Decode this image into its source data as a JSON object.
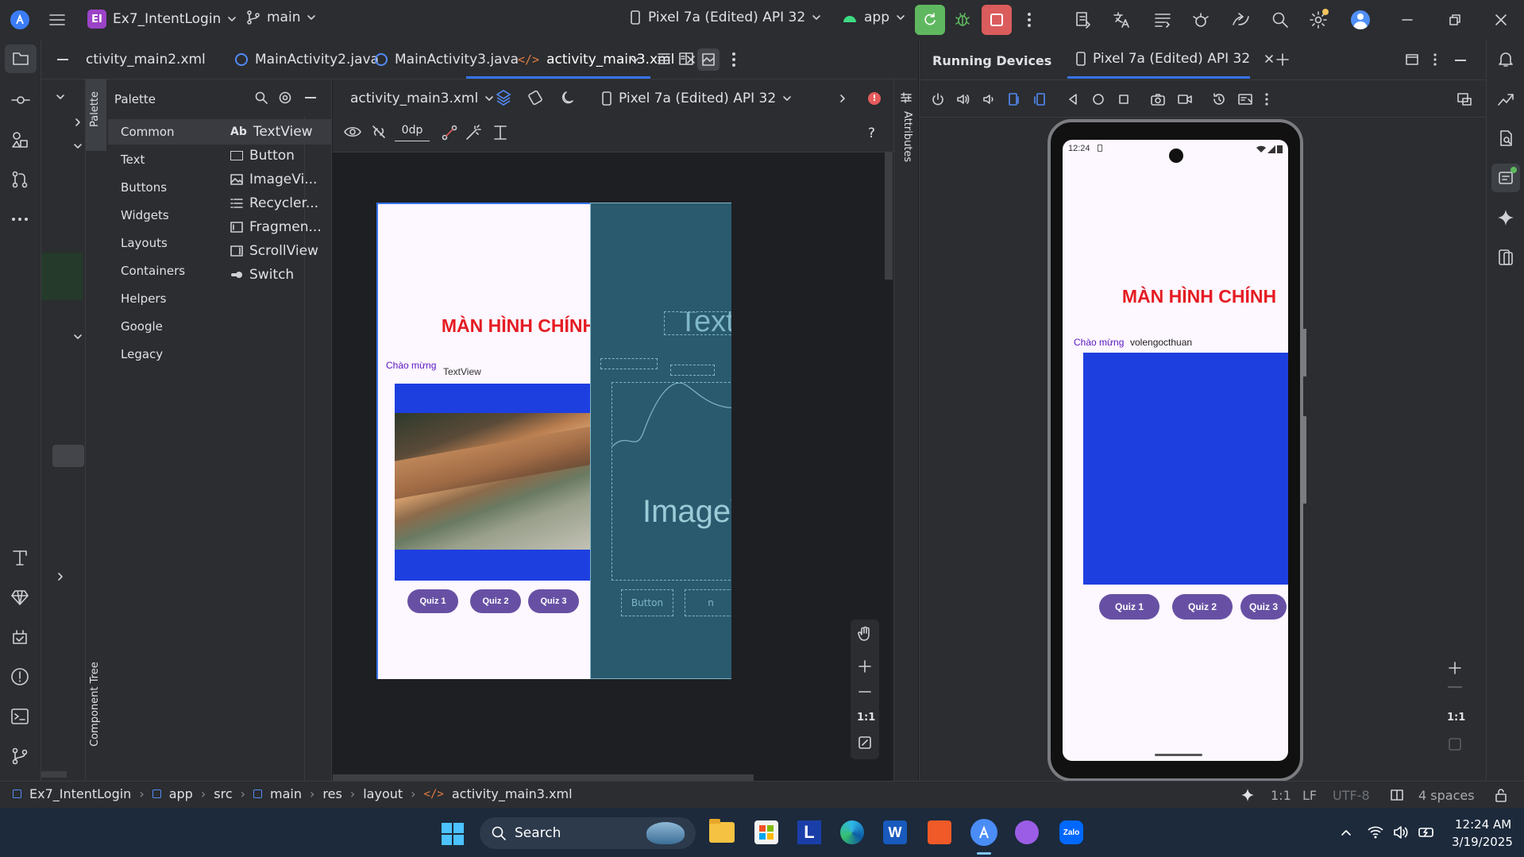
{
  "titlebar": {
    "project_badge": "EI",
    "project_name": "Ex7_IntentLogin",
    "branch": "main",
    "device": "Pixel 7a (Edited) API 32",
    "run_config": "app"
  },
  "tabs": [
    {
      "label": "ctivity_main2.xml",
      "type": "xml"
    },
    {
      "label": "MainActivity2.java",
      "type": "java"
    },
    {
      "label": "MainActivity3.java",
      "type": "java"
    },
    {
      "label": "activity_main3.xml",
      "type": "xml",
      "active": true
    }
  ],
  "palette": {
    "title": "Palette",
    "side_label": "Palette",
    "tree_label": "Component Tree",
    "categories": [
      "Common",
      "Text",
      "Buttons",
      "Widgets",
      "Layouts",
      "Containers",
      "Helpers",
      "Google",
      "Legacy"
    ],
    "items": [
      {
        "icon": "Ab",
        "label": "TextView"
      },
      {
        "icon": "button-icon",
        "label": "Button"
      },
      {
        "icon": "image-icon",
        "label": "ImageVi..."
      },
      {
        "icon": "list-icon",
        "label": "Recycler..."
      },
      {
        "icon": "fragment-icon",
        "label": "Fragmen..."
      },
      {
        "icon": "scroll-icon",
        "label": "ScrollView"
      },
      {
        "icon": "switch-icon",
        "label": "Switch"
      }
    ]
  },
  "design": {
    "file": "activity_main3.xml",
    "device": "Pixel 7a (Edited) API 32",
    "margin": "0dp",
    "help": "?",
    "zoom_reset": "1:1",
    "preview": {
      "title": "MÀN HÌNH CHÍNH",
      "greeting": "Chào mừng",
      "textview": "TextView",
      "buttons": [
        "Quiz 1",
        "Quiz 2",
        "Quiz 3"
      ]
    },
    "blueprint": {
      "text": "TextV",
      "image": "ImageV",
      "button": "Button",
      "button2": "n"
    }
  },
  "attributes_label": "Attributes",
  "running_devices": {
    "title": "Running Devices",
    "device_tab": "Pixel 7a (Edited) API 32",
    "zoom_reset": "1:1",
    "phone": {
      "time": "12:24",
      "title": "MÀN HÌNH CHÍNH",
      "greeting": "Chào mừng",
      "username": "volengocthuan",
      "buttons": [
        "Quiz 1",
        "Quiz 2",
        "Quiz 3"
      ]
    }
  },
  "breadcrumb": [
    "Ex7_IntentLogin",
    "app",
    "src",
    "main",
    "res",
    "layout",
    "activity_main3.xml"
  ],
  "status": {
    "ratio": "1:1",
    "line_sep": "LF",
    "encoding": "UTF-8",
    "indent": "4 spaces"
  },
  "taskbar": {
    "search": "Search",
    "time": "12:24 AM",
    "date": "3/19/2025"
  },
  "colors": {
    "accent": "#3574f0",
    "title_red": "#e51c23",
    "image_blue": "#1e3fe0",
    "quiz_purple": "#6750a4",
    "greeting_purple": "#5b16c2",
    "blueprint": "#2a5a6e"
  }
}
